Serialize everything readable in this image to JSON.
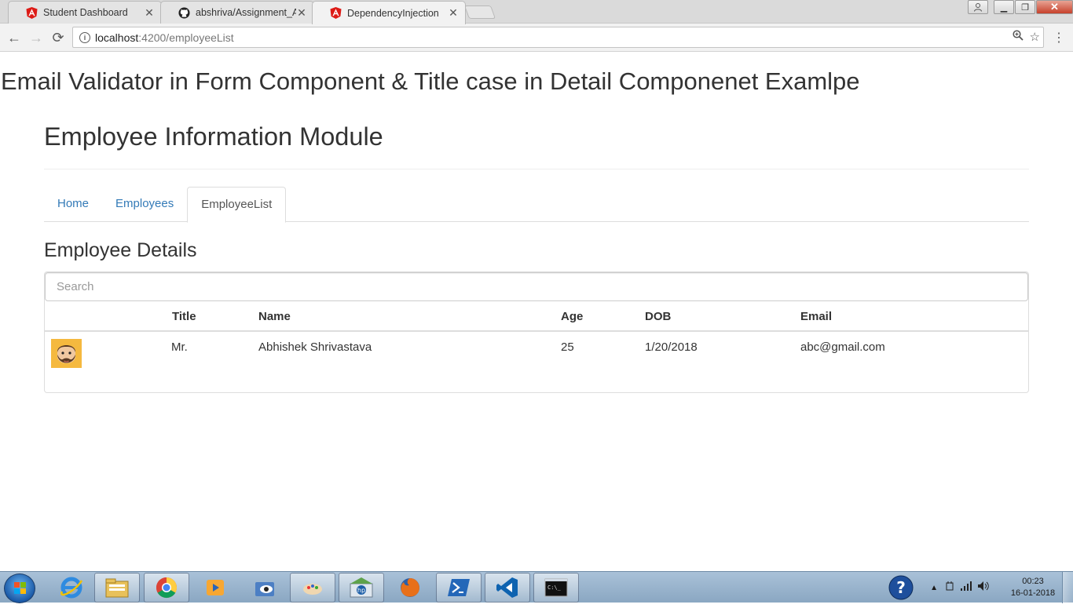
{
  "browser": {
    "tabs": [
      {
        "title": "Student Dashboard",
        "icon": "angular-icon"
      },
      {
        "title": "abshriva/Assignment_Ad",
        "icon": "github-icon"
      },
      {
        "title": "DependencyInjection",
        "icon": "angular-icon"
      }
    ],
    "active_tab": 2,
    "url_host": "localhost",
    "url_path": ":4200/employeeList"
  },
  "page": {
    "heading": "Email Validator in Form Component & Title case in Detail Componenet Examlpe",
    "module_title": "Employee Information Module",
    "nav": [
      "Home",
      "Employees",
      "EmployeeList"
    ],
    "active_nav": 2,
    "section_title": "Employee Details",
    "search_placeholder": "Search",
    "table": {
      "headers": [
        "Title",
        "Name",
        "Age",
        "DOB",
        "Email"
      ],
      "rows": [
        {
          "avatar": "bearded-man-avatar",
          "title": "Mr.",
          "name": "Abhishek Shrivastava",
          "age": "25",
          "dob": "1/20/2018",
          "email": "abc@gmail.com"
        }
      ]
    }
  },
  "taskbar": {
    "items": [
      "ie-icon",
      "explorer-icon",
      "chrome-icon",
      "media-player-icon",
      "preview-icon",
      "paint-icon",
      "hp-icon",
      "firefox-icon",
      "powershell-icon",
      "vscode-icon",
      "cmd-icon"
    ],
    "time": "00:23",
    "date": "16-01-2018"
  },
  "colors": {
    "link": "#337ab7",
    "angular": "#dd1b16",
    "text": "#333333"
  }
}
